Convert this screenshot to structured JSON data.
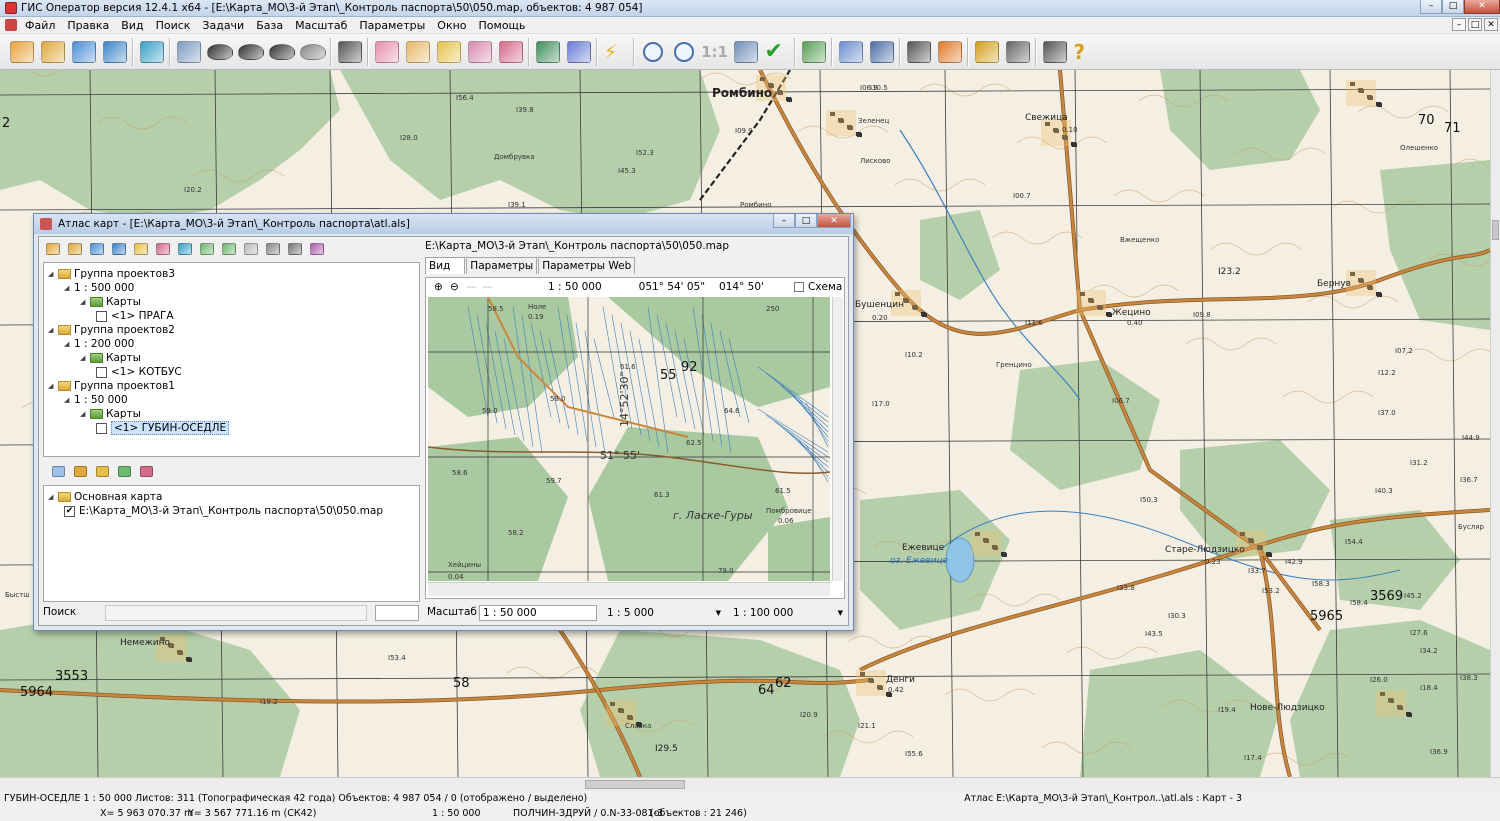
{
  "window": {
    "title": "ГИС Оператор версия 12.4.1 x64 - [E:\\Карта_МО\\3-й Этап\\_Контроль паспорта\\50\\050.map, объектов: 4 987 054]"
  },
  "menu": [
    "Файл",
    "Правка",
    "Вид",
    "Поиск",
    "Задачи",
    "База",
    "Масштаб",
    "Параметры",
    "Окно",
    "Помощь"
  ],
  "toolbar": {
    "icons": [
      "open-folder-icon",
      "open-project-icon",
      "open-atlas-icon",
      "open-globe-icon",
      "layers-icon",
      "list-view-icon",
      "binoculars-icon",
      "binoculars-text-icon",
      "binoculars-more-icon",
      "binoculars-gray-icon",
      "legend-list-icon",
      "select-object-icon",
      "select-area-icon",
      "add-object-icon",
      "edit-object-icon",
      "delete-object-icon",
      "screen-frame-icon",
      "3d-globe-icon",
      "lightning-icon",
      "zoom-out-icon",
      "zoom-in-icon",
      "zoom-1to1-icon",
      "zoom-extent-icon",
      "checkmark-icon",
      "back-arrow-icon",
      "cursor-icon",
      "table-icon",
      "text-edit-icon",
      "pencil-icon",
      "route-icon",
      "print-icon",
      "print-preview-icon",
      "help-icon"
    ],
    "zoom_1_1_label": "1:1"
  },
  "map": {
    "colors": {
      "base": "#f4efe2",
      "forest": "#a9c9a0",
      "grid": "#3c3c3c",
      "water": "#8fc4e6",
      "road": "#c9873e",
      "rail": "#222222",
      "contour": "#c9a070"
    },
    "labels": [
      {
        "text": "Ромбино",
        "cls": "big"
      },
      {
        "text": "Свежица",
        "cls": ""
      },
      {
        "text": "0.10",
        "cls": "num"
      },
      {
        "text": "Бернув",
        "cls": ""
      },
      {
        "text": "Жецино",
        "cls": ""
      },
      {
        "text": "0.40",
        "cls": "num"
      },
      {
        "text": "Зеленец",
        "cls": "num"
      },
      {
        "text": "Лисково",
        "cls": "num"
      },
      {
        "text": "Домбрувка",
        "cls": "num"
      },
      {
        "text": "Вжещенко",
        "cls": "num"
      },
      {
        "text": "Бушенцин",
        "cls": ""
      },
      {
        "text": "0.20",
        "cls": "num"
      },
      {
        "text": "Гренцино",
        "cls": "num"
      },
      {
        "text": "Ежевице",
        "cls": ""
      },
      {
        "text": "оз. Ежевице",
        "cls": "water"
      },
      {
        "text": "Старе-Людзицко",
        "cls": ""
      },
      {
        "text": "0.23",
        "cls": "num"
      },
      {
        "text": "Немежино",
        "cls": ""
      },
      {
        "text": "Денги",
        "cls": ""
      },
      {
        "text": "0.42",
        "cls": "num"
      },
      {
        "text": "Нове-Людзицко",
        "cls": ""
      },
      {
        "text": "Славка",
        "cls": "num"
      },
      {
        "text": "Ромбино",
        "cls": "num"
      },
      {
        "text": "Быстш",
        "cls": "num"
      },
      {
        "text": "Бусляр",
        "cls": "num"
      },
      {
        "text": "Олешенко",
        "cls": "num"
      },
      {
        "text": "I23.2",
        "cls": ""
      },
      {
        "text": "I29.5",
        "cls": ""
      },
      {
        "text": "5965",
        "cls": "grid"
      },
      {
        "text": "5964",
        "cls": "grid"
      },
      {
        "text": "3569",
        "cls": "grid"
      },
      {
        "text": "3553",
        "cls": "grid"
      },
      {
        "text": "58",
        "cls": "grid"
      },
      {
        "text": "62",
        "cls": "grid"
      },
      {
        "text": "64",
        "cls": "grid"
      },
      {
        "text": "70",
        "cls": "grid"
      },
      {
        "text": "71",
        "cls": "grid"
      },
      {
        "text": "2",
        "cls": "grid"
      },
      {
        "text": "I56.4",
        "cls": "num"
      },
      {
        "text": "I39.8",
        "cls": "num"
      },
      {
        "text": "I28.0",
        "cls": "num"
      },
      {
        "text": "I52.3",
        "cls": "num"
      },
      {
        "text": "I45.3",
        "cls": "num"
      },
      {
        "text": "I39.1",
        "cls": "num"
      },
      {
        "text": "I20.2",
        "cls": "num"
      },
      {
        "text": "I09.9",
        "cls": "num"
      },
      {
        "text": "I00.7",
        "cls": "num"
      },
      {
        "text": "I09.8",
        "cls": "num"
      },
      {
        "text": "I10.2",
        "cls": "num"
      },
      {
        "text": "I11.6",
        "cls": "num"
      },
      {
        "text": "I06.7",
        "cls": "num"
      },
      {
        "text": "I17.0",
        "cls": "num"
      },
      {
        "text": "I37.0",
        "cls": "num"
      },
      {
        "text": "I31.2",
        "cls": "num"
      },
      {
        "text": "I12.2",
        "cls": "num"
      },
      {
        "text": "I07.2",
        "cls": "num"
      },
      {
        "text": "I50.3",
        "cls": "num"
      },
      {
        "text": "I40.3",
        "cls": "num"
      },
      {
        "text": "I36.7",
        "cls": "num"
      },
      {
        "text": "I33.8",
        "cls": "num"
      },
      {
        "text": "I43.5",
        "cls": "num"
      },
      {
        "text": "I54.4",
        "cls": "num"
      },
      {
        "text": "I58.4",
        "cls": "num"
      },
      {
        "text": "I53.2",
        "cls": "num"
      },
      {
        "text": "I58.3",
        "cls": "num"
      },
      {
        "text": "I45.2",
        "cls": "num"
      },
      {
        "text": "I42.9",
        "cls": "num"
      },
      {
        "text": "I33.7",
        "cls": "num"
      },
      {
        "text": "I27.6",
        "cls": "num"
      },
      {
        "text": "I36.9",
        "cls": "num"
      },
      {
        "text": "I19.4",
        "cls": "num"
      },
      {
        "text": "I17.4",
        "cls": "num"
      },
      {
        "text": "I55.6",
        "cls": "num"
      },
      {
        "text": "I20.9",
        "cls": "num"
      },
      {
        "text": "I21.1",
        "cls": "num"
      },
      {
        "text": "I19.2",
        "cls": "num"
      },
      {
        "text": "I21.0",
        "cls": "num"
      },
      {
        "text": "I53.4",
        "cls": "num"
      },
      {
        "text": "I34.2",
        "cls": "num"
      },
      {
        "text": "I38.3",
        "cls": "num"
      },
      {
        "text": "I18.4",
        "cls": "num"
      },
      {
        "text": "I30.3",
        "cls": "num"
      },
      {
        "text": "I44.9",
        "cls": "num"
      },
      {
        "text": "I26.0",
        "cls": "num"
      },
      {
        "text": "I06.9",
        "cls": "num"
      },
      {
        "text": "I10.5",
        "cls": "num"
      }
    ]
  },
  "atlas": {
    "title": "Атлас карт - [E:\\Карта_МО\\3-й Этап\\_Контроль паспорта\\atl.als]",
    "toolbar_icons": [
      "open-atlas-icon",
      "open-project-icon",
      "save-icon",
      "properties-icon",
      "new-icon",
      "delete-icon",
      "export-icon",
      "refresh-icon",
      "sync-icon",
      "print-icon",
      "print-preview-icon",
      "find-icon",
      "book-icon"
    ],
    "tree": [
      {
        "label": "Группа проектов3",
        "level": 0,
        "type": "group"
      },
      {
        "label": "1 : 500 000",
        "level": 1,
        "type": "scale"
      },
      {
        "label": "Карты",
        "level": 2,
        "type": "maps"
      },
      {
        "label": "<1> ПРАГА",
        "level": 3,
        "type": "item",
        "checked": false
      },
      {
        "label": "Группа проектов2",
        "level": 0,
        "type": "group"
      },
      {
        "label": "1 : 200 000",
        "level": 1,
        "type": "scale"
      },
      {
        "label": "Карты",
        "level": 2,
        "type": "maps"
      },
      {
        "label": "<1> КОТБУС",
        "level": 3,
        "type": "item",
        "checked": false
      },
      {
        "label": "Группа проектов1",
        "level": 0,
        "type": "group"
      },
      {
        "label": "1 : 50 000",
        "level": 1,
        "type": "scale"
      },
      {
        "label": "Карты",
        "level": 2,
        "type": "maps"
      },
      {
        "label": "<1> ГУБИН-ОСЕДЛЕ",
        "level": 3,
        "type": "item",
        "checked": false,
        "selected": true
      }
    ],
    "tree2_icons": [
      "refresh-icon",
      "add-map-icon",
      "folder-add-icon",
      "add-icon",
      "remove-icon"
    ],
    "tree2": [
      {
        "label": "Основная карта",
        "level": 0,
        "type": "group"
      },
      {
        "label": "E:\\Карта_МО\\3-й Этап\\_Контроль паспорта\\50\\050.map",
        "level": 1,
        "type": "item",
        "checked": true
      }
    ],
    "search_label": "Поиск",
    "path": "E:\\Карта_МО\\3-й Этап\\_Контроль паспорта\\50\\050.map",
    "tabs": [
      "Вид",
      "Параметры",
      "Параметры Web"
    ],
    "preview": {
      "scale": "1 : 50 000",
      "lat": "051° 54' 05\"",
      "lon": "014° 50'",
      "schema_label": "Схема",
      "labels": [
        "Ноле",
        "0.19",
        "58.5",
        "61.6",
        "55",
        "92",
        "59.0",
        "58.0",
        "62.5",
        "64.6",
        "51° 55'",
        "14°52'30\"",
        "58.6",
        "59.7",
        "61.3",
        "61.5",
        "58.2",
        "г. Ласке-Гуры",
        "Помбровице",
        "0.06",
        "Хейцины",
        "0.04",
        "79.0",
        "250"
      ]
    },
    "scale_label": "Масштаб",
    "scale_value": "1 : 50 000",
    "scale_min": "1 : 5 000",
    "scale_max": "1 : 100 000"
  },
  "status": {
    "left": "ГУБИН-ОСЕДЛЕ  1 : 50 000  Листов: 311  (Топографическая 42 года)  Объектов: 4 987 054 / 0 (отображено / выделено)",
    "right": "Атлас E:\\Карта_МО\\3-й Этап\\_Контрол..\\atl.als : Карт - 3",
    "x": "X= 5 963 070.37 m",
    "y": "Y= 3 567 771.16 m  (СК42)",
    "scale": "1 : 50 000",
    "sheet": "ПОЛЧИН-ЗДРУЙ / 0.N-33-081-3",
    "objects": "(объектов : 21 246)"
  }
}
